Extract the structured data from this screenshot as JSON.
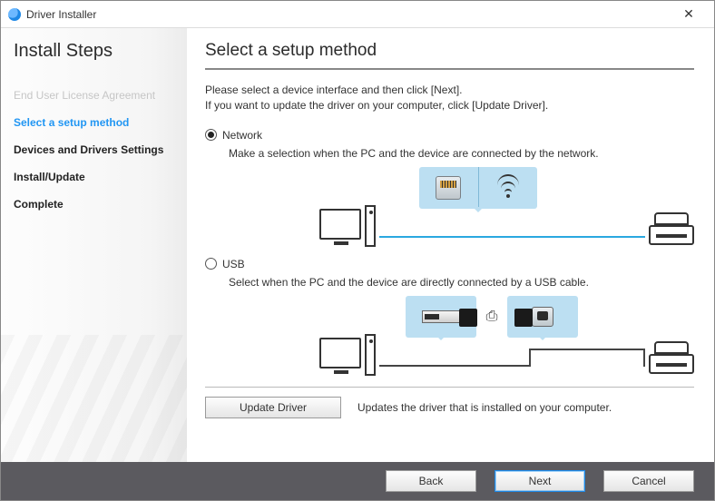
{
  "window": {
    "title": "Driver Installer"
  },
  "sidebar": {
    "heading": "Install Steps",
    "steps": [
      {
        "label": "End User License Agreement",
        "state": "disabled"
      },
      {
        "label": "Select a setup method",
        "state": "active"
      },
      {
        "label": "Devices and Drivers Settings",
        "state": "normal"
      },
      {
        "label": "Install/Update",
        "state": "normal"
      },
      {
        "label": "Complete",
        "state": "normal"
      }
    ]
  },
  "main": {
    "heading": "Select a setup method",
    "intro_line1": "Please select a device interface and then click [Next].",
    "intro_line2": "If you want to update the driver on your computer, click [Update Driver].",
    "options": {
      "network": {
        "label": "Network",
        "checked": true,
        "description": "Make a selection when the PC and the device are connected by the network."
      },
      "usb": {
        "label": "USB",
        "checked": false,
        "description": "Select when the PC and the device are directly connected by a USB cable."
      }
    },
    "update_button": "Update Driver",
    "update_description": "Updates the driver that is installed on your computer."
  },
  "footer": {
    "back": "Back",
    "next": "Next",
    "cancel": "Cancel"
  }
}
